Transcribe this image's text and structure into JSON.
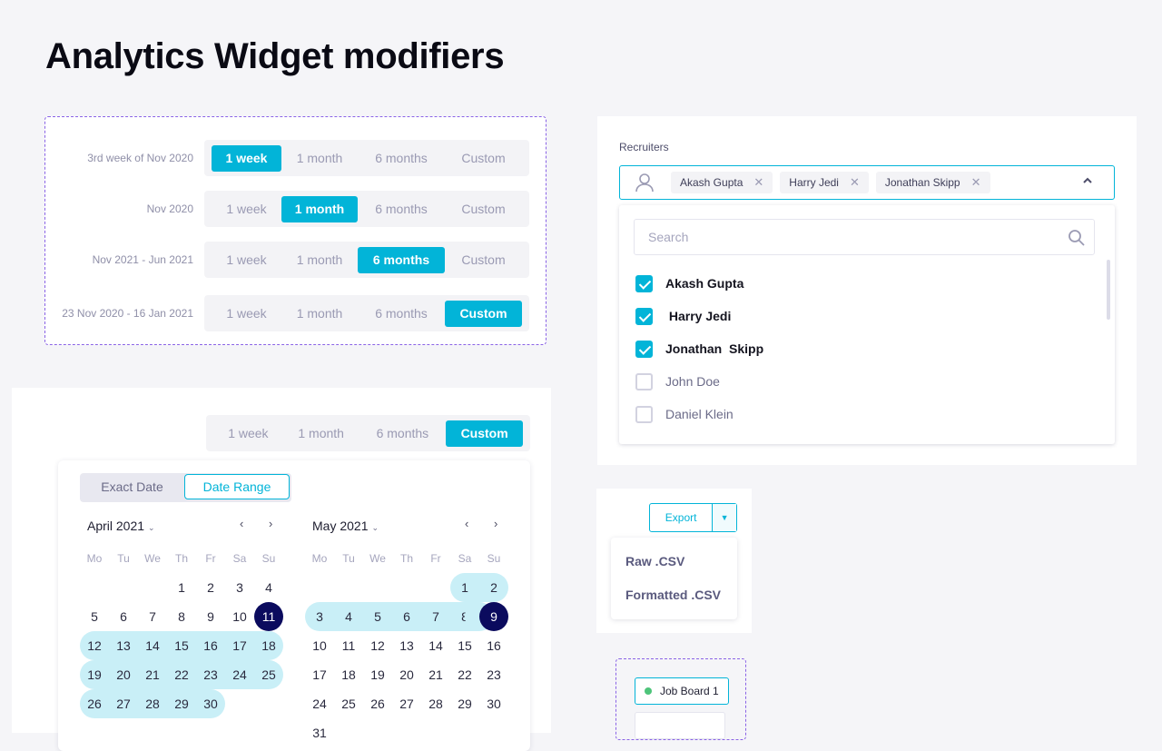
{
  "page_title": "Analytics Widget modifiers",
  "colors": {
    "accent": "#02b4d8",
    "selected_day": "#0b0b5e",
    "range_fill": "#c9eff7",
    "dashed_border": "#8a63e6",
    "status_green": "#4ec47a"
  },
  "period_options": [
    "1 week",
    "1 month",
    "6 months",
    "Custom"
  ],
  "period_rows": [
    {
      "label": "3rd week of Nov 2020",
      "active": "1 week"
    },
    {
      "label": "Nov 2020",
      "active": "1 month"
    },
    {
      "label": "Nov 2021 - Jun 2021",
      "active": "6 months"
    },
    {
      "label": "23 Nov 2020 - 16 Jan 2021",
      "active": "Custom"
    }
  ],
  "calendar": {
    "period_active": "Custom",
    "mode_tabs": {
      "exact": "Exact Date",
      "range": "Date Range",
      "active": "Date Range"
    },
    "weekdays": [
      "Mo",
      "Tu",
      "We",
      "Th",
      "Fr",
      "Sa",
      "Su"
    ],
    "months": [
      {
        "title": "April 2021",
        "first_weekday": 3,
        "days": 30,
        "prev": "‹",
        "next": "›"
      },
      {
        "title": "May 2021",
        "first_weekday": 5,
        "days": 31,
        "prev": "‹",
        "next": "›"
      }
    ],
    "range_start": "April 11",
    "range_end": "May 9"
  },
  "recruiters": {
    "label": "Recruiters",
    "chips": [
      "Akash Gupta",
      "Harry Jedi",
      "Jonathan  Skipp"
    ],
    "search_placeholder": "Search",
    "options": [
      {
        "name": "Akash Gupta",
        "checked": true
      },
      {
        "name": " Harry Jedi",
        "checked": true
      },
      {
        "name": "Jonathan  Skipp",
        "checked": true
      },
      {
        "name": "John Doe",
        "checked": false
      },
      {
        "name": "Daniel Klein",
        "checked": false
      }
    ]
  },
  "export": {
    "label": "Export",
    "caret": "⌄",
    "items": [
      "Raw .CSV",
      "Formatted .CSV"
    ]
  },
  "job_board": {
    "label": "Job Board 1"
  }
}
